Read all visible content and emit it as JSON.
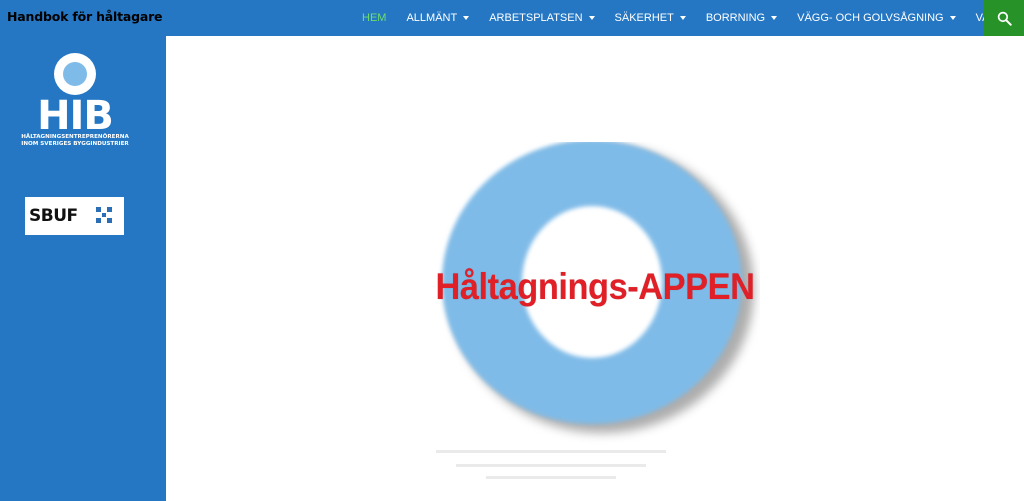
{
  "header": {
    "site_title": "Handbok för håltagare",
    "search_icon": "search-icon"
  },
  "nav": {
    "items": [
      {
        "label": "HEM",
        "active": true,
        "has_dropdown": false
      },
      {
        "label": "ALLMÄNT",
        "active": false,
        "has_dropdown": true
      },
      {
        "label": "ARBETSPLATSEN",
        "active": false,
        "has_dropdown": true
      },
      {
        "label": "SÄKERHET",
        "active": false,
        "has_dropdown": true
      },
      {
        "label": "BORRNING",
        "active": false,
        "has_dropdown": true
      },
      {
        "label": "VÄGG- OCH GOLVSÅGNING",
        "active": false,
        "has_dropdown": true
      },
      {
        "label": "VAJERSÅGNING",
        "active": false,
        "has_dropdown": true
      }
    ]
  },
  "sidebar": {
    "hib_logo": {
      "letters": "HIB",
      "line1": "HÅLTAGNINGSENTREPRENÖRERNA",
      "line2": "INOM SVERIGES BYGGINDUSTRIER"
    },
    "sbuf_logo": {
      "letters": "SBUF"
    }
  },
  "main": {
    "app_title": "Håltagnings-APPEN"
  },
  "colors": {
    "header_bg": "#2577c4",
    "sidebar_bg": "#2577c4",
    "active_nav": "#6ddd6d",
    "search_bg": "#279227",
    "ring": "#7fbbe8",
    "title_red": "#e01f26"
  }
}
